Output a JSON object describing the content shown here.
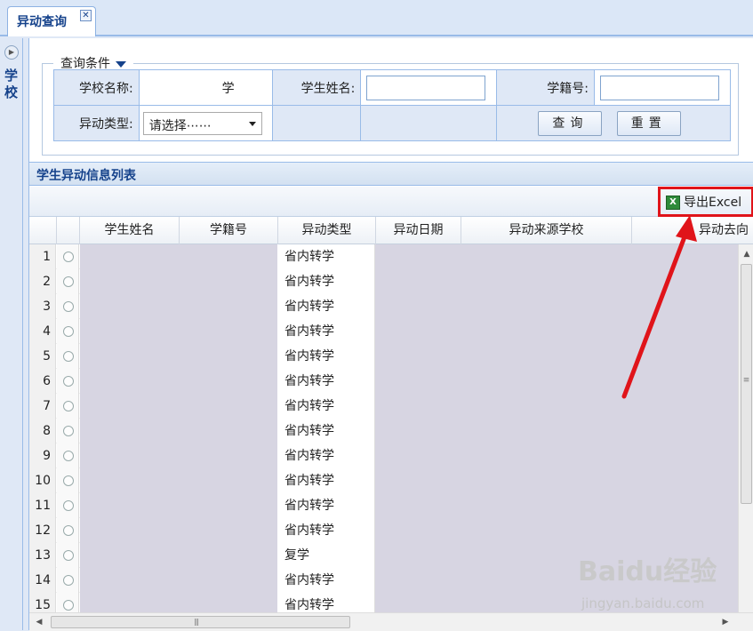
{
  "tab": {
    "label": "异动查询",
    "close_glyph": "✕"
  },
  "west": {
    "label": "学校",
    "toggle_glyph": "▶"
  },
  "query": {
    "legend": "查询条件",
    "school_label": "学校名称:",
    "school_value": "学",
    "student_name_label": "学生姓名:",
    "student_name_value": "",
    "student_id_label": "学籍号:",
    "student_id_value": "",
    "change_type_label": "异动类型:",
    "change_type_selected": "请选择⋯⋯",
    "search_button": "查询",
    "reset_button": "重置"
  },
  "grid": {
    "title": "学生异动信息列表",
    "export_button": "导出Excel",
    "export_icon": "excel-icon",
    "columns": [
      "学生姓名",
      "学籍号",
      "异动类型",
      "异动日期",
      "异动来源学校",
      "异动去向"
    ],
    "rows": [
      {
        "num": "1",
        "type": "省内转学"
      },
      {
        "num": "2",
        "type": "省内转学"
      },
      {
        "num": "3",
        "type": "省内转学"
      },
      {
        "num": "4",
        "type": "省内转学"
      },
      {
        "num": "5",
        "type": "省内转学"
      },
      {
        "num": "6",
        "type": "省内转学"
      },
      {
        "num": "7",
        "type": "省内转学"
      },
      {
        "num": "8",
        "type": "省内转学"
      },
      {
        "num": "9",
        "type": "省内转学"
      },
      {
        "num": "10",
        "type": "省内转学"
      },
      {
        "num": "11",
        "type": "省内转学"
      },
      {
        "num": "12",
        "type": "省内转学"
      },
      {
        "num": "13",
        "type": "复学"
      },
      {
        "num": "14",
        "type": "省内转学"
      },
      {
        "num": "15",
        "type": "省内转学"
      }
    ]
  },
  "watermark": {
    "logo": "Baidu经验",
    "url": "jingyan.baidu.com"
  },
  "colors": {
    "highlight_red": "#e0141a",
    "header_blue": "#15428b"
  }
}
